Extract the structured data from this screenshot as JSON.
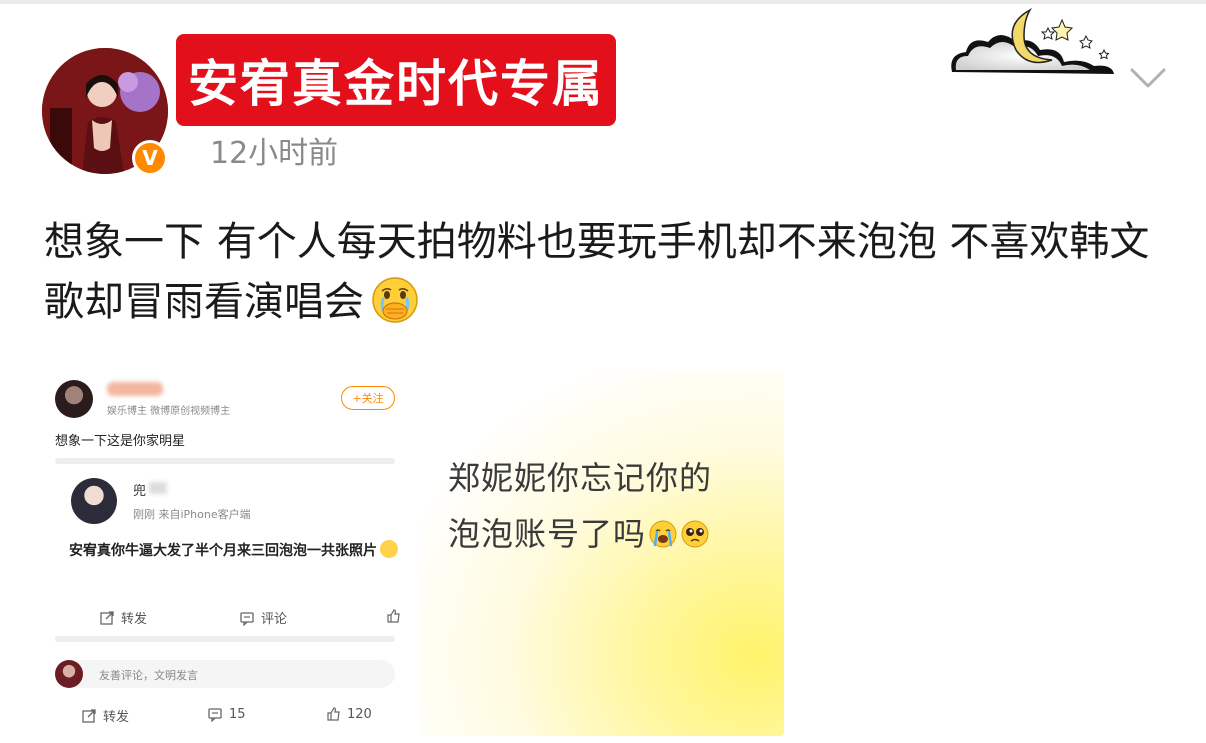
{
  "header": {
    "username": "安宥真金时代专属",
    "time": "12小时前",
    "verified_badge": "V"
  },
  "post": {
    "text": "想象一下 有个人每天拍物料也要玩手机却不来泡泡 不喜欢韩文歌却冒雨看演唱会",
    "emoji": "crying-face-covering-mouth"
  },
  "left_image": {
    "follow_label": "+关注",
    "sub_label": "娱乐博主 微博原创视频博主",
    "caption": "想象一下这是你家明星",
    "reply_name": "兜",
    "reply_sub": "刚刚 来自iPhone客户端",
    "reply_text": "安宥真你牛逼大发了半个月来三回泡泡一共张照片",
    "repost_label": "转发",
    "comment_label": "评论",
    "comment_placeholder": "友善评论，文明发言",
    "bottom_repost": "转发",
    "bottom_comments": "15",
    "bottom_likes": "120"
  },
  "right_image": {
    "line1": "郑妮妮你忘记你的",
    "line2": "泡泡账号了吗"
  },
  "colors": {
    "name_bg": "#e3101b",
    "badge": "#ff8a00",
    "time": "#8a8a8a"
  }
}
